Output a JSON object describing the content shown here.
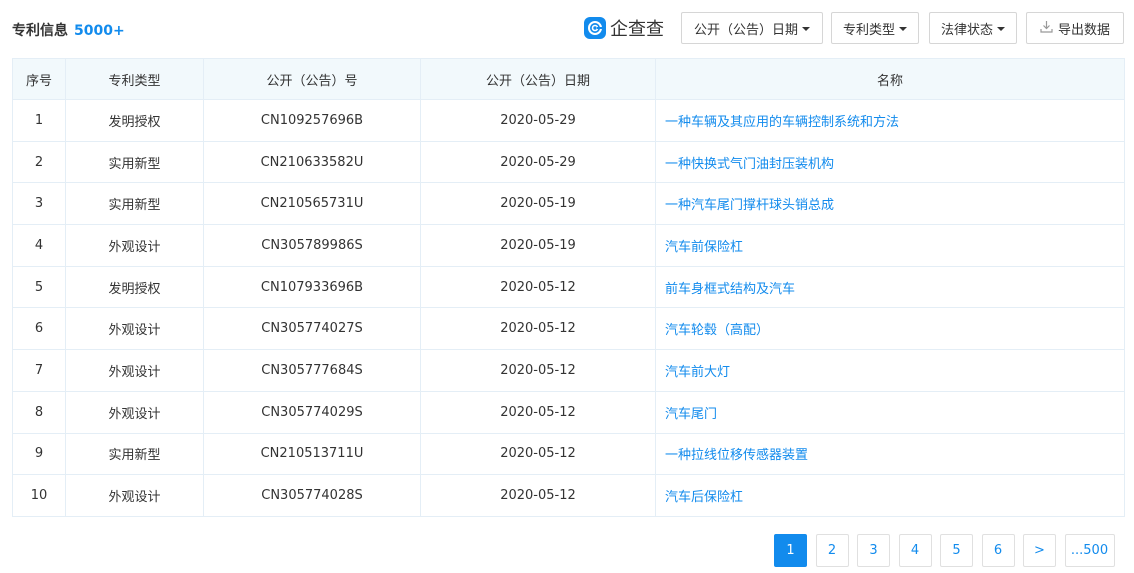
{
  "header": {
    "title": "专利信息",
    "count": "5000+",
    "logo_text": "企查查",
    "filters": {
      "date_label": "公开（公告）日期",
      "type_label": "专利类型",
      "legal_label": "法律状态"
    },
    "export_label": "导出数据"
  },
  "table": {
    "columns": [
      "序号",
      "专利类型",
      "公开（公告）号",
      "公开（公告）日期",
      "名称"
    ],
    "rows": [
      {
        "idx": "1",
        "type": "发明授权",
        "number": "CN109257696B",
        "date": "2020-05-29",
        "name": "一种车辆及其应用的车辆控制系统和方法"
      },
      {
        "idx": "2",
        "type": "实用新型",
        "number": "CN210633582U",
        "date": "2020-05-29",
        "name": "一种快换式气门油封压装机构"
      },
      {
        "idx": "3",
        "type": "实用新型",
        "number": "CN210565731U",
        "date": "2020-05-19",
        "name": "一种汽车尾门撑杆球头销总成"
      },
      {
        "idx": "4",
        "type": "外观设计",
        "number": "CN305789986S",
        "date": "2020-05-19",
        "name": "汽车前保险杠"
      },
      {
        "idx": "5",
        "type": "发明授权",
        "number": "CN107933696B",
        "date": "2020-05-12",
        "name": "前车身框式结构及汽车"
      },
      {
        "idx": "6",
        "type": "外观设计",
        "number": "CN305774027S",
        "date": "2020-05-12",
        "name": "汽车轮毂（高配）"
      },
      {
        "idx": "7",
        "type": "外观设计",
        "number": "CN305777684S",
        "date": "2020-05-12",
        "name": "汽车前大灯"
      },
      {
        "idx": "8",
        "type": "外观设计",
        "number": "CN305774029S",
        "date": "2020-05-12",
        "name": "汽车尾门"
      },
      {
        "idx": "9",
        "type": "实用新型",
        "number": "CN210513711U",
        "date": "2020-05-12",
        "name": "一种拉线位移传感器装置"
      },
      {
        "idx": "10",
        "type": "外观设计",
        "number": "CN305774028S",
        "date": "2020-05-12",
        "name": "汽车后保险杠"
      }
    ]
  },
  "pagination": {
    "pages": [
      "1",
      "2",
      "3",
      "4",
      "5",
      "6"
    ],
    "current": "1",
    "next": ">",
    "last": "...500"
  },
  "colors": {
    "accent": "#128bed",
    "header_bg": "#f2f9fc",
    "border": "#e4eef6"
  },
  "icons": {
    "logo": "qichacha-logo-icon",
    "export": "download-icon",
    "dropdown": "caret-down-icon"
  }
}
